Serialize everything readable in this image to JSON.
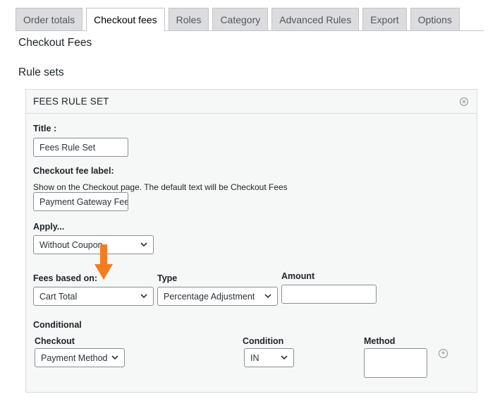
{
  "tabs": [
    {
      "label": "Order totals"
    },
    {
      "label": "Checkout fees"
    },
    {
      "label": "Roles"
    },
    {
      "label": "Category"
    },
    {
      "label": "Advanced Rules"
    },
    {
      "label": "Export"
    },
    {
      "label": "Options"
    }
  ],
  "active_tab": "Checkout fees",
  "page_title": "Checkout Fees",
  "section_title": "Rule sets",
  "ruleset": {
    "header": "FEES RULE SET",
    "title_label": "Title :",
    "title_value": "Fees Rule Set",
    "fee_label_label": "Checkout fee label:",
    "fee_label_desc": "Show on the Checkout page. The default text will be Checkout Fees",
    "fee_label_value": "Payment Gateway Fee",
    "apply_label": "Apply...",
    "apply_value": "Without Coupon",
    "fees_based_label": "Fees based on:",
    "fees_based_value": "Cart Total",
    "type_label": "Type",
    "type_value": "Percentage Adjustment",
    "amount_label": "Amount",
    "amount_value": "",
    "conditional_label": "Conditional",
    "checkout_label": "Checkout",
    "checkout_value": "Payment Method",
    "condition_label": "Condition",
    "condition_value": "IN",
    "method_label": "Method",
    "method_value": ""
  },
  "colors": {
    "arrow": "#f47c20",
    "tab_inactive_bg": "#dcdcde",
    "panel_bg": "#f6f7f7"
  }
}
